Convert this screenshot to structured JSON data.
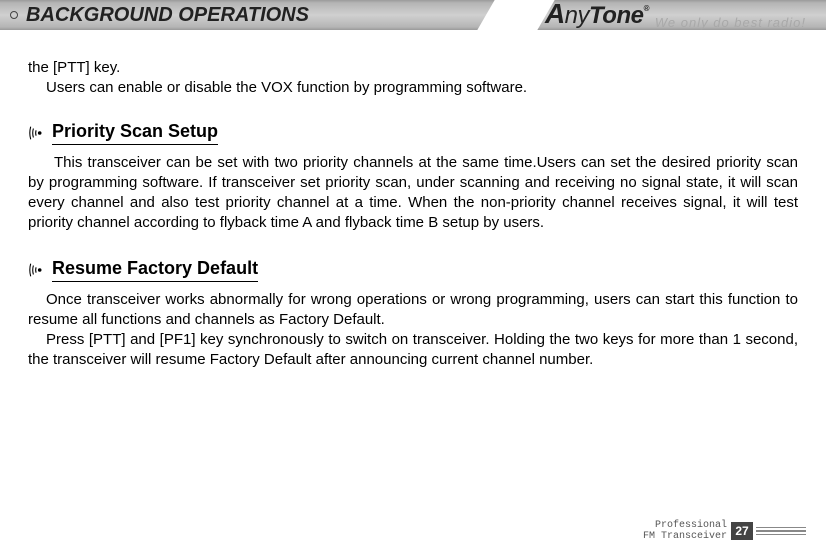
{
  "header": {
    "title": "BACKGROUND OPERATIONS",
    "brand": "AnyTone",
    "slogan": "We only do best radio!"
  },
  "intro": {
    "line1": "the [PTT] key.",
    "line2": "Users can enable or disable the VOX function by programming software."
  },
  "section1": {
    "heading": "Priority Scan Setup",
    "body": "This transceiver can be set with two priority channels at the same time.Users can set the desired priority scan by programming software. If transceiver set priority scan, under scanning and receiving no signal state, it will scan every channel and also test priority channel at a time. When the non-priority channel receives signal, it will test priority channel according to flyback time A and flyback time B setup by users."
  },
  "section2": {
    "heading": "Resume Factory Default",
    "para1": "Once transceiver works abnormally for wrong operations or wrong programming, users can start this function to resume all functions and channels as Factory Default.",
    "para2": "Press [PTT] and [PF1] key synchronously to switch on transceiver. Holding the two keys for more than 1 second, the transceiver will resume Factory Default after announcing current channel number."
  },
  "footer": {
    "line1": "Professional",
    "line2": "FM Transceiver",
    "page": "27"
  }
}
